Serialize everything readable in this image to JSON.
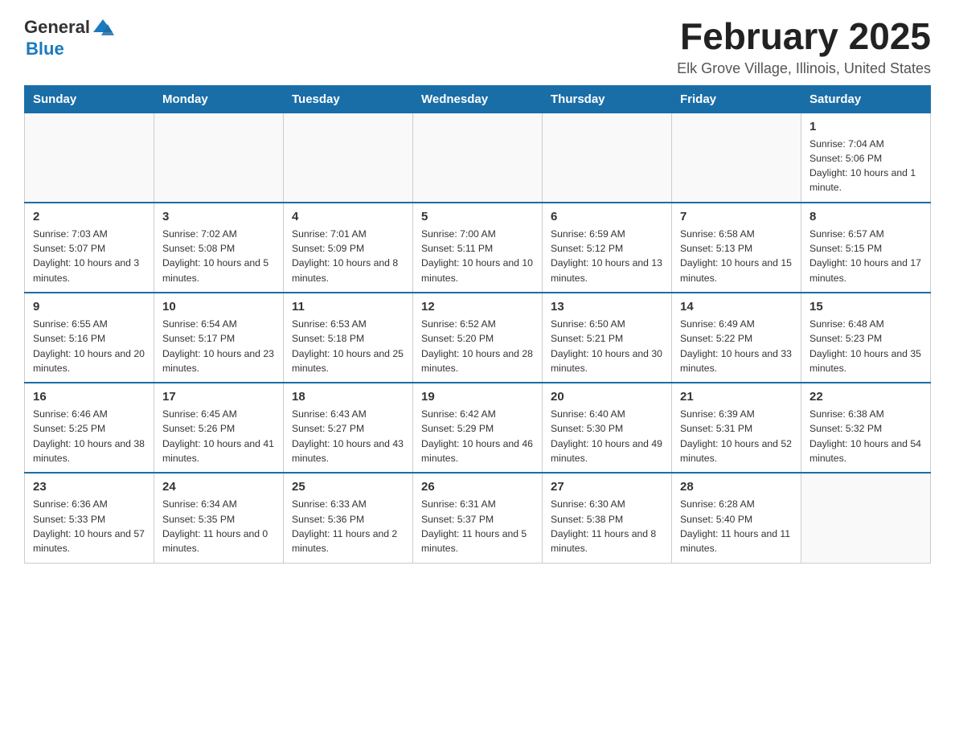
{
  "header": {
    "logo_general": "General",
    "logo_blue": "Blue",
    "month_title": "February 2025",
    "location": "Elk Grove Village, Illinois, United States"
  },
  "weekdays": [
    "Sunday",
    "Monday",
    "Tuesday",
    "Wednesday",
    "Thursday",
    "Friday",
    "Saturday"
  ],
  "weeks": [
    [
      {
        "day": "",
        "info": ""
      },
      {
        "day": "",
        "info": ""
      },
      {
        "day": "",
        "info": ""
      },
      {
        "day": "",
        "info": ""
      },
      {
        "day": "",
        "info": ""
      },
      {
        "day": "",
        "info": ""
      },
      {
        "day": "1",
        "info": "Sunrise: 7:04 AM\nSunset: 5:06 PM\nDaylight: 10 hours and 1 minute."
      }
    ],
    [
      {
        "day": "2",
        "info": "Sunrise: 7:03 AM\nSunset: 5:07 PM\nDaylight: 10 hours and 3 minutes."
      },
      {
        "day": "3",
        "info": "Sunrise: 7:02 AM\nSunset: 5:08 PM\nDaylight: 10 hours and 5 minutes."
      },
      {
        "day": "4",
        "info": "Sunrise: 7:01 AM\nSunset: 5:09 PM\nDaylight: 10 hours and 8 minutes."
      },
      {
        "day": "5",
        "info": "Sunrise: 7:00 AM\nSunset: 5:11 PM\nDaylight: 10 hours and 10 minutes."
      },
      {
        "day": "6",
        "info": "Sunrise: 6:59 AM\nSunset: 5:12 PM\nDaylight: 10 hours and 13 minutes."
      },
      {
        "day": "7",
        "info": "Sunrise: 6:58 AM\nSunset: 5:13 PM\nDaylight: 10 hours and 15 minutes."
      },
      {
        "day": "8",
        "info": "Sunrise: 6:57 AM\nSunset: 5:15 PM\nDaylight: 10 hours and 17 minutes."
      }
    ],
    [
      {
        "day": "9",
        "info": "Sunrise: 6:55 AM\nSunset: 5:16 PM\nDaylight: 10 hours and 20 minutes."
      },
      {
        "day": "10",
        "info": "Sunrise: 6:54 AM\nSunset: 5:17 PM\nDaylight: 10 hours and 23 minutes."
      },
      {
        "day": "11",
        "info": "Sunrise: 6:53 AM\nSunset: 5:18 PM\nDaylight: 10 hours and 25 minutes."
      },
      {
        "day": "12",
        "info": "Sunrise: 6:52 AM\nSunset: 5:20 PM\nDaylight: 10 hours and 28 minutes."
      },
      {
        "day": "13",
        "info": "Sunrise: 6:50 AM\nSunset: 5:21 PM\nDaylight: 10 hours and 30 minutes."
      },
      {
        "day": "14",
        "info": "Sunrise: 6:49 AM\nSunset: 5:22 PM\nDaylight: 10 hours and 33 minutes."
      },
      {
        "day": "15",
        "info": "Sunrise: 6:48 AM\nSunset: 5:23 PM\nDaylight: 10 hours and 35 minutes."
      }
    ],
    [
      {
        "day": "16",
        "info": "Sunrise: 6:46 AM\nSunset: 5:25 PM\nDaylight: 10 hours and 38 minutes."
      },
      {
        "day": "17",
        "info": "Sunrise: 6:45 AM\nSunset: 5:26 PM\nDaylight: 10 hours and 41 minutes."
      },
      {
        "day": "18",
        "info": "Sunrise: 6:43 AM\nSunset: 5:27 PM\nDaylight: 10 hours and 43 minutes."
      },
      {
        "day": "19",
        "info": "Sunrise: 6:42 AM\nSunset: 5:29 PM\nDaylight: 10 hours and 46 minutes."
      },
      {
        "day": "20",
        "info": "Sunrise: 6:40 AM\nSunset: 5:30 PM\nDaylight: 10 hours and 49 minutes."
      },
      {
        "day": "21",
        "info": "Sunrise: 6:39 AM\nSunset: 5:31 PM\nDaylight: 10 hours and 52 minutes."
      },
      {
        "day": "22",
        "info": "Sunrise: 6:38 AM\nSunset: 5:32 PM\nDaylight: 10 hours and 54 minutes."
      }
    ],
    [
      {
        "day": "23",
        "info": "Sunrise: 6:36 AM\nSunset: 5:33 PM\nDaylight: 10 hours and 57 minutes."
      },
      {
        "day": "24",
        "info": "Sunrise: 6:34 AM\nSunset: 5:35 PM\nDaylight: 11 hours and 0 minutes."
      },
      {
        "day": "25",
        "info": "Sunrise: 6:33 AM\nSunset: 5:36 PM\nDaylight: 11 hours and 2 minutes."
      },
      {
        "day": "26",
        "info": "Sunrise: 6:31 AM\nSunset: 5:37 PM\nDaylight: 11 hours and 5 minutes."
      },
      {
        "day": "27",
        "info": "Sunrise: 6:30 AM\nSunset: 5:38 PM\nDaylight: 11 hours and 8 minutes."
      },
      {
        "day": "28",
        "info": "Sunrise: 6:28 AM\nSunset: 5:40 PM\nDaylight: 11 hours and 11 minutes."
      },
      {
        "day": "",
        "info": ""
      }
    ]
  ]
}
